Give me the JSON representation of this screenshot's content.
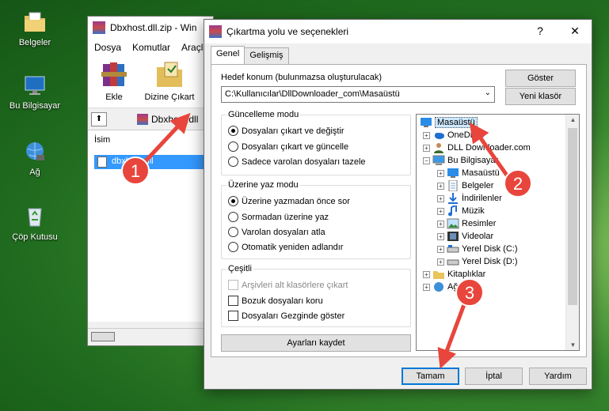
{
  "desktop": {
    "icons": [
      {
        "label": "Belgeler"
      },
      {
        "label": "Bu Bilgisayar"
      },
      {
        "label": "Ağ"
      },
      {
        "label": "Çöp Kutusu"
      }
    ]
  },
  "winrar": {
    "title": "Dbxhost.dll.zip - Win",
    "menu": [
      "Dosya",
      "Komutlar",
      "Araçla"
    ],
    "toolbar": [
      "Ekle",
      "Dizine Çıkart"
    ],
    "address": "Dbxhost.dll",
    "column": "İsim",
    "file": "dbxhost.dll"
  },
  "dialog": {
    "title": "Çıkartma yolu ve seçenekleri",
    "help": "?",
    "close": "✕",
    "tabs": [
      "Genel",
      "Gelişmiş"
    ],
    "dest_label": "Hedef konum (bulunmazsa oluşturulacak)",
    "dest_value": "C:\\Kullanıcılar\\DllDownloader_com\\Masaüstü",
    "show_button": "Göster",
    "new_folder_button": "Yeni klasör",
    "update_group": {
      "title": "Güncelleme modu",
      "options": [
        "Dosyaları çıkart ve değiştir",
        "Dosyaları çıkart ve güncelle",
        "Sadece varolan dosyaları tazele"
      ],
      "selected": 0
    },
    "overwrite_group": {
      "title": "Üzerine yaz modu",
      "options": [
        "Üzerine yazmadan önce sor",
        "Sormadan üzerine yaz",
        "Varolan dosyaları atla",
        "Otomatik yeniden adlandır"
      ],
      "selected": 0
    },
    "misc_group": {
      "title": "Çeşitli",
      "options": [
        "Arşivleri alt klasörlere çıkart",
        "Bozuk dosyaları koru",
        "Dosyaları Gezginde göster"
      ]
    },
    "save_button": "Ayarları kaydet",
    "tree": [
      {
        "label": "Masaüstü",
        "icon": "desktop-icon"
      },
      {
        "label": "OneDrive",
        "icon": "cloud-icon"
      },
      {
        "label": "DLL Downloader.com",
        "icon": "user-icon"
      },
      {
        "label": "Bu Bilgisayar",
        "icon": "computer-icon"
      },
      {
        "label": "Masaüstü",
        "icon": "desktop-icon"
      },
      {
        "label": "Belgeler",
        "icon": "document-icon"
      },
      {
        "label": "İndirilenler",
        "icon": "download-icon"
      },
      {
        "label": "Müzik",
        "icon": "music-icon"
      },
      {
        "label": "Resimler",
        "icon": "picture-icon"
      },
      {
        "label": "Videolar",
        "icon": "video-icon"
      },
      {
        "label": "Yerel Disk (C:)",
        "icon": "drive-icon"
      },
      {
        "label": "Yerel Disk (D:)",
        "icon": "drive-icon"
      },
      {
        "label": "Kitaplıklar",
        "icon": "folder-icon"
      },
      {
        "label": "Ağ",
        "icon": "network-icon"
      }
    ],
    "ok_button": "Tamam",
    "cancel_button": "İptal",
    "help_button": "Yardım"
  },
  "annotations": [
    "1",
    "2",
    "3"
  ],
  "colors": {
    "annotation": "#e8453c",
    "selection": "#3399ff",
    "accent": "#0078d7"
  }
}
